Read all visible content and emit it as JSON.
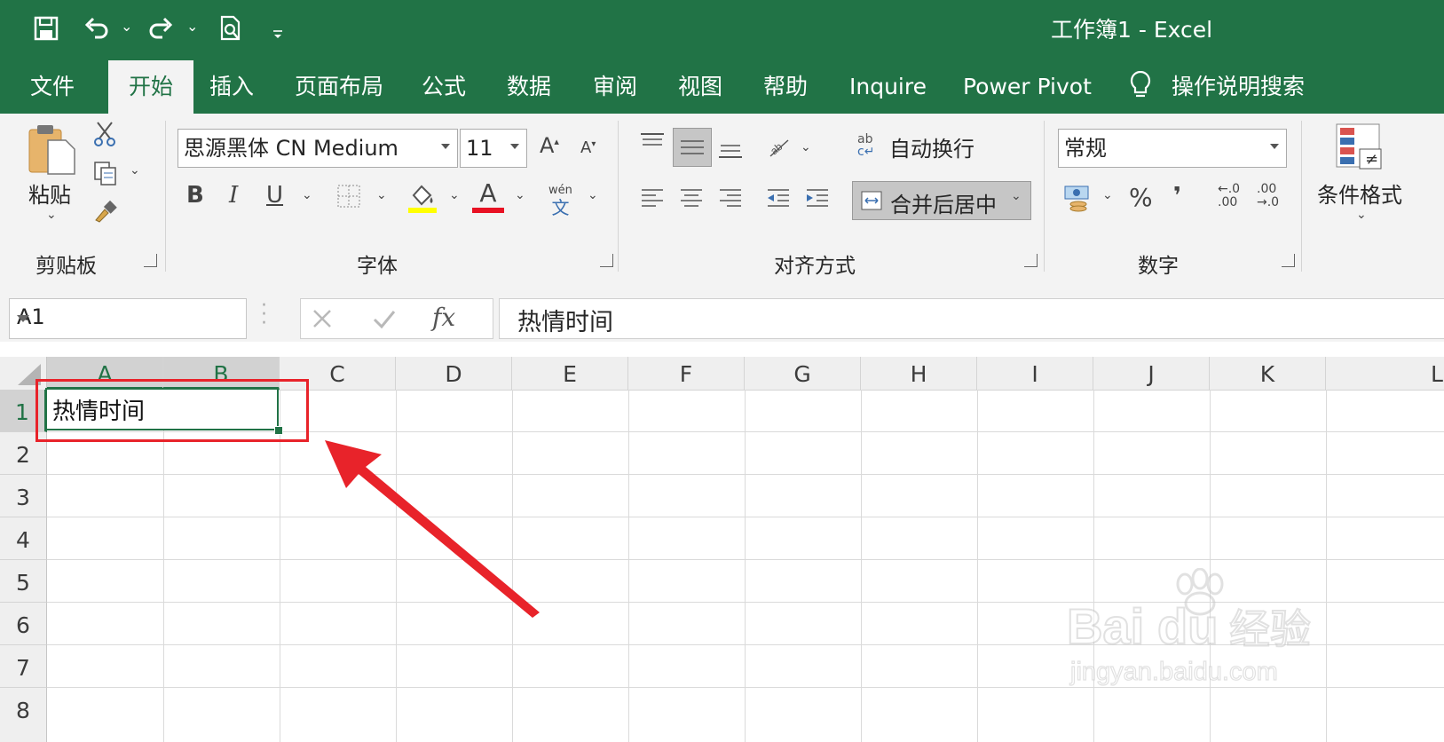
{
  "title_bar": {
    "doc_title": "工作簿1  -  Excel",
    "qat": [
      {
        "name": "save-icon",
        "glyph": "💾"
      },
      {
        "name": "undo-icon",
        "glyph": "↶"
      },
      {
        "name": "redo-icon",
        "glyph": "↷"
      },
      {
        "name": "print-preview-icon",
        "glyph": "🔍"
      }
    ]
  },
  "tabs": [
    "文件",
    "开始",
    "插入",
    "页面布局",
    "公式",
    "数据",
    "审阅",
    "视图",
    "帮助",
    "Inquire",
    "Power Pivot"
  ],
  "active_tab": "开始",
  "tell_me": "操作说明搜索",
  "clipboard": {
    "paste_label": "粘贴",
    "group_label": "剪贴板"
  },
  "font": {
    "family": "思源黑体 CN Medium",
    "size": "11",
    "group_label": "字体",
    "phonetic_top": "wén",
    "phonetic_bottom": "文",
    "bold": "B",
    "italic": "I",
    "underline": "U",
    "grow": "A",
    "shrink": "A",
    "font_color_letter": "A"
  },
  "alignment": {
    "wrap_text": "自动换行",
    "merge_center": "合并后居中",
    "group_label": "对齐方式",
    "wrap_icon_text": "ab"
  },
  "number": {
    "format": "常规",
    "group_label": "数字",
    "percent": "%",
    "comma": "❜",
    "inc_decimal": "←.0 .00",
    "dec_decimal": ".00 →.0"
  },
  "styles": {
    "conditional_format": "条件格式"
  },
  "formula_bar": {
    "name_box": "A1",
    "content": "热情时间",
    "fx": "fx"
  },
  "columns": [
    "A",
    "B",
    "C",
    "D",
    "E",
    "F",
    "G",
    "H",
    "I",
    "J",
    "K",
    "L"
  ],
  "rows": [
    "1",
    "2",
    "3",
    "4",
    "5",
    "6",
    "7",
    "8"
  ],
  "cells": {
    "A1": "热情时间"
  },
  "colors": {
    "accent": "#217346",
    "annotation": "#e8232a"
  },
  "watermark": {
    "brand": "Baidu经验",
    "url": "jingyan.baidu.com"
  }
}
